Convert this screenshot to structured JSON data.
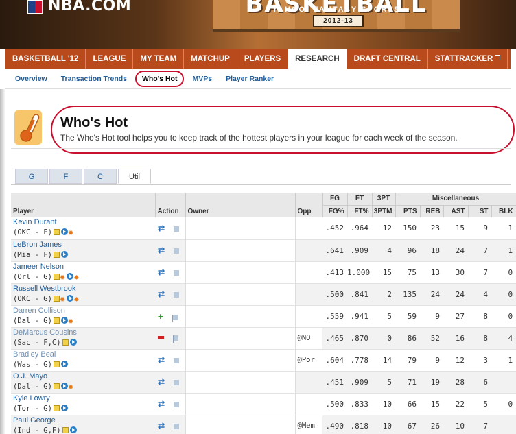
{
  "banner": {
    "site": "NBA.COM",
    "title": "BASKETBALL",
    "tagline": "YAHOO! FANTASY SPORTS",
    "season": "2012-13"
  },
  "mainnav": {
    "tabs": [
      {
        "label": "BASKETBALL '12",
        "active": false
      },
      {
        "label": "LEAGUE",
        "active": false
      },
      {
        "label": "MY TEAM",
        "active": false
      },
      {
        "label": "MATCHUP",
        "active": false
      },
      {
        "label": "PLAYERS",
        "active": false
      },
      {
        "label": "RESEARCH",
        "active": true
      },
      {
        "label": "DRAFT CENTRAL",
        "active": false
      },
      {
        "label": "STATTRACKER",
        "active": false,
        "external": true
      }
    ]
  },
  "subnav": {
    "items": [
      {
        "label": "Overview",
        "active": false
      },
      {
        "label": "Transaction Trends",
        "active": false
      },
      {
        "label": "Who's Hot",
        "active": true
      },
      {
        "label": "MVPs",
        "active": false
      },
      {
        "label": "Player Ranker",
        "active": false
      }
    ]
  },
  "header": {
    "icon": "thermometer-icon",
    "title": "Who's Hot",
    "description": "The Who's Hot tool helps you to keep track of the hottest players in your league for each week of the season."
  },
  "position_tabs": [
    {
      "label": "G",
      "active": false
    },
    {
      "label": "F",
      "active": false
    },
    {
      "label": "C",
      "active": false
    },
    {
      "label": "Util",
      "active": true
    }
  ],
  "table": {
    "group_headers": {
      "fg": "FG",
      "ft": "FT",
      "threept": "3PT",
      "misc": "Miscellaneous"
    },
    "columns": {
      "player": "Player",
      "action": "Action",
      "owner": "Owner",
      "opp": "Opp",
      "fgp": "FG%",
      "ftp": "FT%",
      "threeptm": "3PTM",
      "pts": "PTS",
      "reb": "REB",
      "ast": "AST",
      "st": "ST",
      "blk": "BLK"
    },
    "rows": [
      {
        "name": "Kevin Durant",
        "team": "(OKC - F)",
        "action": "trade",
        "opp": "",
        "fgp": ".452",
        "ftp": ".964",
        "threeptm": "12",
        "pts": "150",
        "reb": "23",
        "ast": "15",
        "st": "9",
        "blk": "1",
        "icons": [
          "note",
          "play",
          "hot"
        ],
        "injured": false
      },
      {
        "name": "LeBron James",
        "team": "(Mia - F)",
        "action": "trade",
        "opp": "",
        "fgp": ".641",
        "ftp": ".909",
        "threeptm": "4",
        "pts": "96",
        "reb": "18",
        "ast": "24",
        "st": "7",
        "blk": "1",
        "icons": [
          "note",
          "play"
        ],
        "injured": false
      },
      {
        "name": "Jameer Nelson",
        "team": "(Orl - G)",
        "action": "trade",
        "opp": "",
        "fgp": ".413",
        "ftp": "1.000",
        "threeptm": "15",
        "pts": "75",
        "reb": "13",
        "ast": "30",
        "st": "7",
        "blk": "0",
        "icons": [
          "note",
          "hot",
          "play",
          "hot"
        ],
        "injured": false
      },
      {
        "name": "Russell Westbrook",
        "team": "(OKC - G)",
        "action": "trade",
        "opp": "",
        "fgp": ".500",
        "ftp": ".841",
        "threeptm": "2",
        "pts": "135",
        "reb": "24",
        "ast": "24",
        "st": "4",
        "blk": "0",
        "icons": [
          "note",
          "hot",
          "play",
          "hot"
        ],
        "injured": false
      },
      {
        "name": "Darren Collison",
        "team": "(Dal - G)",
        "action": "add",
        "opp": "",
        "fgp": ".559",
        "ftp": ".941",
        "threeptm": "5",
        "pts": "59",
        "reb": "9",
        "ast": "27",
        "st": "8",
        "blk": "0",
        "icons": [
          "note",
          "play",
          "hot"
        ],
        "injured": true
      },
      {
        "name": "DeMarcus Cousins",
        "team": "(Sac - F,C)",
        "action": "drop",
        "opp": "@NO",
        "fgp": ".465",
        "ftp": ".870",
        "threeptm": "0",
        "pts": "86",
        "reb": "52",
        "ast": "16",
        "st": "8",
        "blk": "4",
        "icons": [
          "note",
          "play"
        ],
        "injured": true
      },
      {
        "name": "Bradley Beal",
        "team": "(Was - G)",
        "action": "trade",
        "opp": "@Por",
        "fgp": ".604",
        "ftp": ".778",
        "threeptm": "14",
        "pts": "79",
        "reb": "9",
        "ast": "12",
        "st": "3",
        "blk": "1",
        "icons": [
          "note",
          "play"
        ],
        "injured": true
      },
      {
        "name": "O.J. Mayo",
        "team": "(Dal - G)",
        "action": "trade",
        "opp": "",
        "fgp": ".451",
        "ftp": ".909",
        "threeptm": "5",
        "pts": "71",
        "reb": "19",
        "ast": "28",
        "st": "6",
        "blk": "",
        "icons": [
          "note",
          "play",
          "hot"
        ],
        "injured": false
      },
      {
        "name": "Kyle Lowry",
        "team": "(Tor - G)",
        "action": "trade",
        "opp": "",
        "fgp": ".500",
        "ftp": ".833",
        "threeptm": "10",
        "pts": "66",
        "reb": "15",
        "ast": "22",
        "st": "5",
        "blk": "0",
        "icons": [
          "note",
          "play"
        ],
        "injured": false
      },
      {
        "name": "Paul George",
        "team": "(Ind - G,F)",
        "action": "trade",
        "opp": "@Mem",
        "fgp": ".490",
        "ftp": ".818",
        "threeptm": "10",
        "pts": "67",
        "reb": "26",
        "ast": "10",
        "st": "7",
        "blk": "",
        "icons": [
          "note",
          "play"
        ],
        "injured": false
      }
    ]
  },
  "colors": {
    "nav": "#b84a1c",
    "link": "#1f5c99",
    "highlight": "#c8102e"
  }
}
